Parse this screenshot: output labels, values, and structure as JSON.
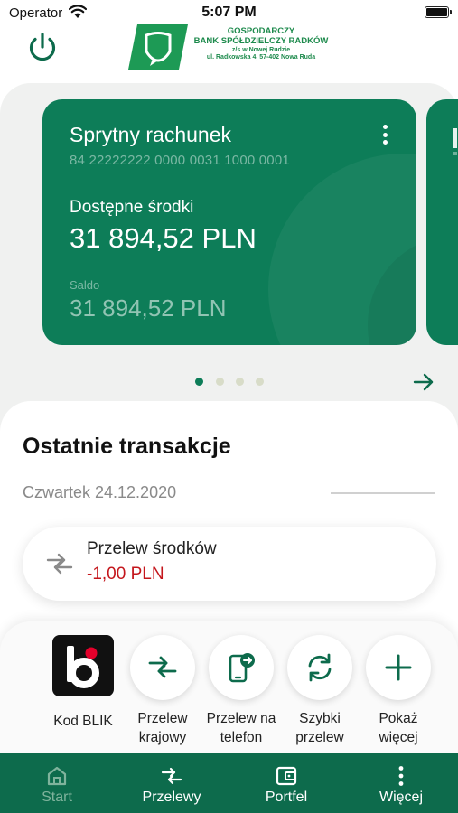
{
  "status_bar": {
    "carrier": "Operator",
    "time": "5:07 PM"
  },
  "header": {
    "logo_lines": [
      "GOSPODARCZY",
      "BANK SPÓŁDZIELCZY RADKÓW",
      "z/s w Nowej Rudzie",
      "ul. Radkowska 4, 57-402 Nowa Ruda"
    ],
    "power_icon": "power-icon"
  },
  "account_card": {
    "name": "Sprytny rachunek",
    "number": "84 22222222 0000 0031 1000 0001",
    "available_label": "Dostępne środki",
    "available_value": "31 894,52 PLN",
    "saldo_label": "Saldo",
    "saldo_value": "31 894,52 PLN",
    "menu_icon": "more-vertical-icon"
  },
  "carousel": {
    "page_count": 4,
    "active_index": 0,
    "next_icon": "arrow-right-icon"
  },
  "transactions": {
    "title": "Ostatnie transakcje",
    "date": "Czwartek 24.12.2020",
    "items": [
      {
        "name": "Przelew środków",
        "amount": "-1,00 PLN",
        "icon": "transfer-arrows-icon"
      }
    ]
  },
  "quick_actions": [
    {
      "label": "Kod BLIK",
      "icon": "blik-logo"
    },
    {
      "label": "Przelew\nkrajowy",
      "icon": "transfer-arrows-icon"
    },
    {
      "label": "Przelew na\ntelefon",
      "icon": "phone-transfer-icon"
    },
    {
      "label": "Szybki\nprzelew",
      "icon": "refresh-icon"
    },
    {
      "label": "Pokaż\nwięcej",
      "icon": "plus-icon"
    }
  ],
  "tab_bar": {
    "active": "Start",
    "tabs": [
      {
        "label": "Start",
        "icon": "home-icon"
      },
      {
        "label": "Przelewy",
        "icon": "transfer-arrows-icon"
      },
      {
        "label": "Portfel",
        "icon": "wallet-icon"
      },
      {
        "label": "Więcej",
        "icon": "more-vertical-icon"
      }
    ]
  },
  "colors": {
    "brand_green": "#0d7d58",
    "tab_bar_green": "#0d6b4c",
    "negative_amount": "#c4161c",
    "blik_red": "#e4002b"
  }
}
